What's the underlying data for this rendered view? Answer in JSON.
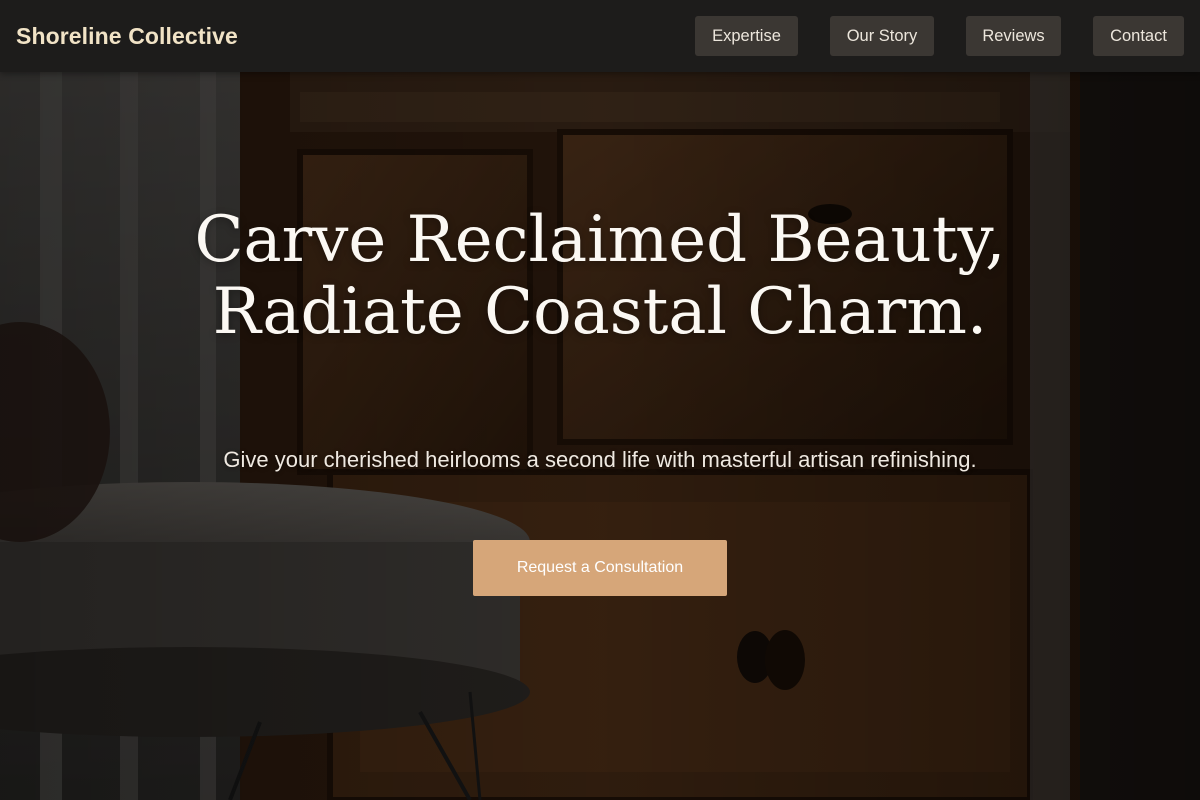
{
  "nav": {
    "brand": "Shoreline Collective",
    "links": [
      "Expertise",
      "Our Story",
      "Reviews",
      "Contact"
    ]
  },
  "hero": {
    "headline": "Carve Reclaimed Beauty, Radiate Coastal Charm.",
    "subtitle": "Give your cherished heirlooms a second life with masterful artisan refinishing.",
    "cta_label": "Request a Consultation"
  },
  "colors": {
    "nav_background": "#1d1c1b",
    "brand_text": "#f1e3c6",
    "nav_button": "#3b3733",
    "cta_background": "#d6a679",
    "headline_text": "#fbf8f3"
  }
}
